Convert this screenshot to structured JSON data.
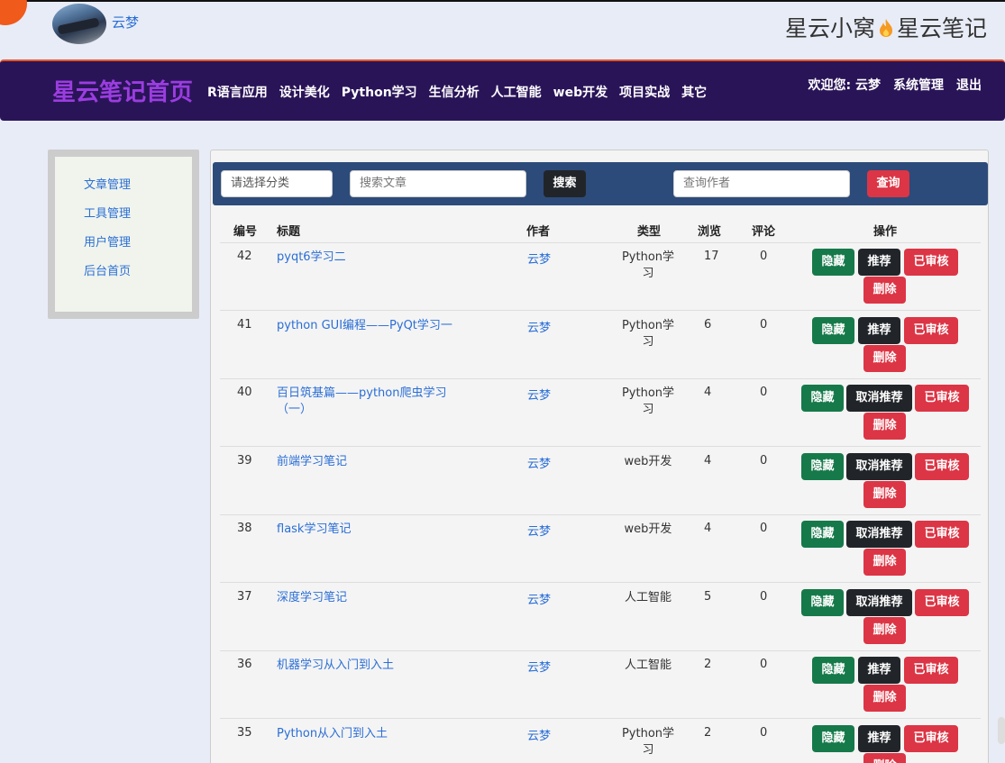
{
  "header": {
    "username": "云梦",
    "site_title_left": "星云小窝",
    "site_title_right": "星云笔记"
  },
  "navbar": {
    "brand": "星云笔记首页",
    "items": [
      "R语言应用",
      "设计美化",
      "Python学习",
      "生信分析",
      "人工智能",
      "web开发",
      "项目实战",
      "其它"
    ],
    "welcome": "欢迎您: 云梦",
    "admin": "系统管理",
    "logout": "退出"
  },
  "sidebar": {
    "items": [
      "文章管理",
      "工具管理",
      "用户管理",
      "后台首页"
    ]
  },
  "search": {
    "category_placeholder": "请选择分类",
    "article_placeholder": "搜索文章",
    "search_button": "搜索",
    "author_placeholder": "查询作者",
    "query_button": "查询"
  },
  "table": {
    "headers": {
      "id": "编号",
      "title": "标题",
      "author": "作者",
      "type": "类型",
      "views": "浏览",
      "comments": "评论",
      "actions": "操作"
    },
    "rows": [
      {
        "id": "42",
        "title": "pyqt6学习二",
        "author": "云梦",
        "type": "Python学习",
        "views": "17",
        "comments": "0",
        "hide": "隐藏",
        "recommend": "推荐",
        "review": "已审核",
        "delete": "删除"
      },
      {
        "id": "41",
        "title": "python GUI编程——PyQt学习一",
        "author": "云梦",
        "type": "Python学习",
        "views": "6",
        "comments": "0",
        "hide": "隐藏",
        "recommend": "推荐",
        "review": "已审核",
        "delete": "删除"
      },
      {
        "id": "40",
        "title": "百日筑基篇——python爬虫学习（一）",
        "author": "云梦",
        "type": "Python学习",
        "views": "4",
        "comments": "0",
        "hide": "隐藏",
        "recommend": "取消推荐",
        "review": "已审核",
        "delete": "删除"
      },
      {
        "id": "39",
        "title": "前端学习笔记",
        "author": "云梦",
        "type": "web开发",
        "views": "4",
        "comments": "0",
        "hide": "隐藏",
        "recommend": "取消推荐",
        "review": "已审核",
        "delete": "删除"
      },
      {
        "id": "38",
        "title": "flask学习笔记",
        "author": "云梦",
        "type": "web开发",
        "views": "4",
        "comments": "0",
        "hide": "隐藏",
        "recommend": "取消推荐",
        "review": "已审核",
        "delete": "删除"
      },
      {
        "id": "37",
        "title": "深度学习笔记",
        "author": "云梦",
        "type": "人工智能",
        "views": "5",
        "comments": "0",
        "hide": "隐藏",
        "recommend": "取消推荐",
        "review": "已审核",
        "delete": "删除"
      },
      {
        "id": "36",
        "title": "机器学习从入门到入土",
        "author": "云梦",
        "type": "人工智能",
        "views": "2",
        "comments": "0",
        "hide": "隐藏",
        "recommend": "推荐",
        "review": "已审核",
        "delete": "删除"
      },
      {
        "id": "35",
        "title": "Python从入门到入土",
        "author": "云梦",
        "type": "Python学习",
        "views": "2",
        "comments": "0",
        "hide": "隐藏",
        "recommend": "推荐",
        "review": "已审核",
        "delete": "删除"
      }
    ]
  },
  "colors": {
    "navbar_bg": "#2a1458",
    "brand": "#9b3de0",
    "search_bar_bg": "#2d4b7a",
    "green": "#16794a",
    "dark": "#212529",
    "red": "#dc3545",
    "link": "#2a6ed6"
  },
  "icons": {
    "flame": "flame-icon"
  }
}
